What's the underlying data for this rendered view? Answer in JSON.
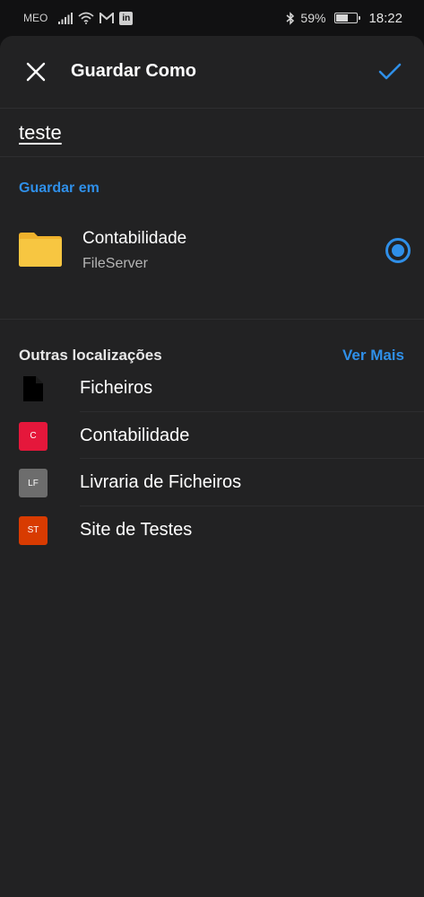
{
  "status_bar": {
    "carrier": "MEO",
    "battery": "59%",
    "battery_level": 0.59,
    "time": "18:22",
    "app_badge": "in"
  },
  "header": {
    "title": "Guardar Como"
  },
  "filename": {
    "value": "teste"
  },
  "save_in": {
    "label": "Guardar em",
    "location_name": "Contabilidade",
    "location_sub": "FileServer",
    "folder_color": "#f7c641"
  },
  "other_locations": {
    "label": "Outras localizações",
    "more_label": "Ver Mais",
    "items": [
      {
        "label": "Ficheiros",
        "icon": "file-icon"
      },
      {
        "label": "Contabilidade",
        "initials": "C",
        "color": "#e5173b"
      },
      {
        "label": "Livraria de Ficheiros",
        "initials": "LF",
        "color": "#6d6d6d"
      },
      {
        "label": "Site de Testes",
        "initials": "ST",
        "color": "#d83b01"
      }
    ]
  },
  "colors": {
    "accent": "#2f8fe8",
    "sheet": "#222223",
    "background": "#111112"
  }
}
